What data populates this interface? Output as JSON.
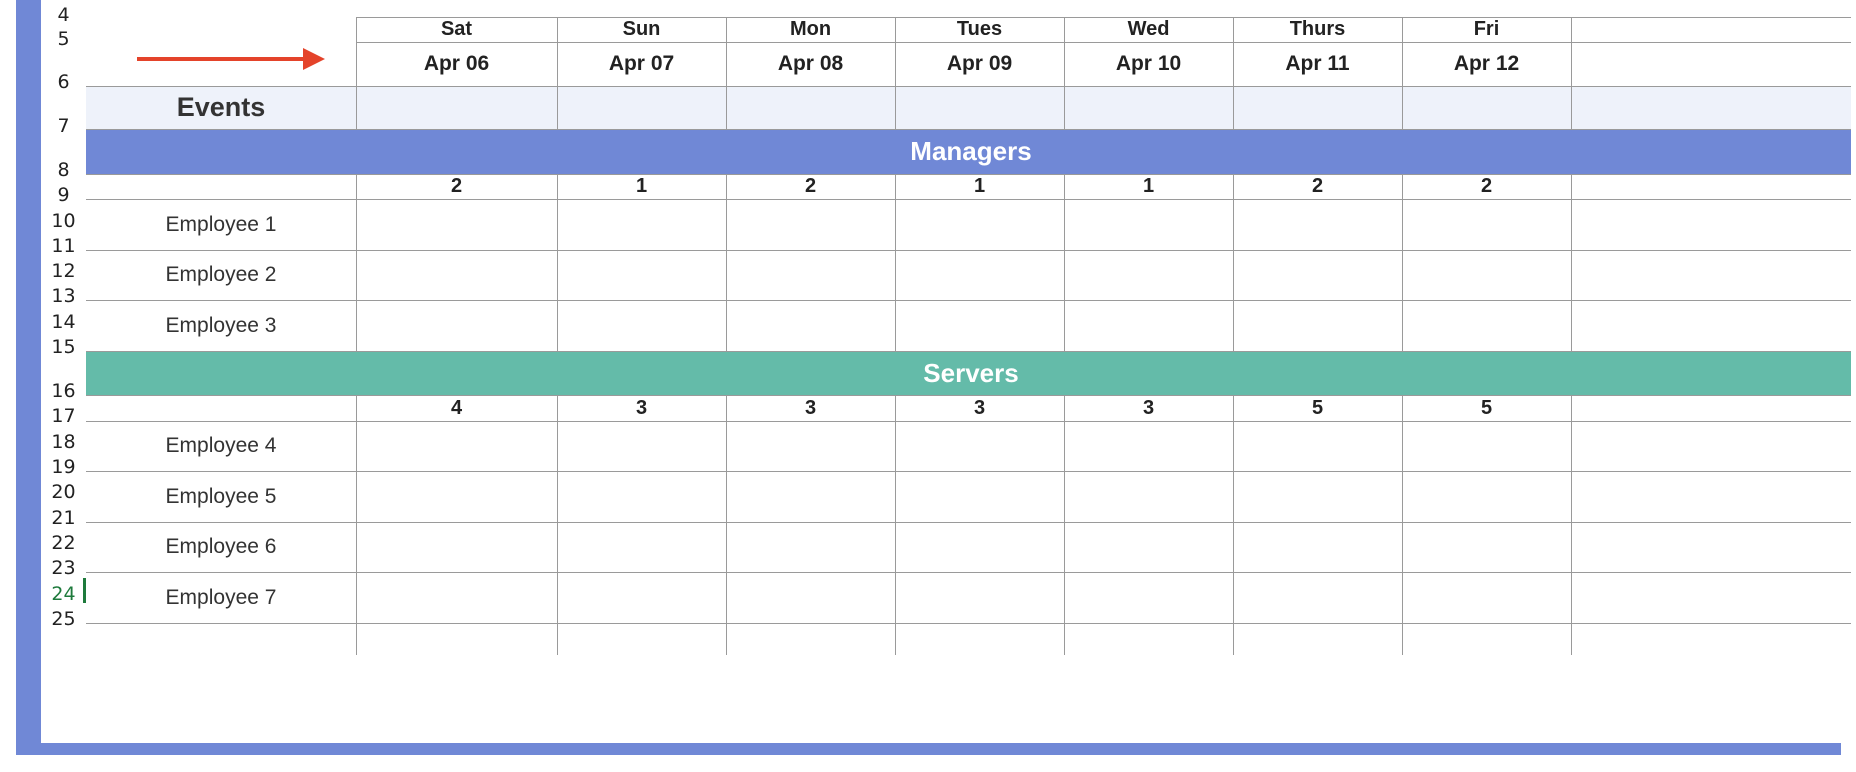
{
  "row_numbers": {
    "r4": "4",
    "r5": "5",
    "r6": "6",
    "r7": "7",
    "r8": "8",
    "r9": "9",
    "r10": "10",
    "r11": "11",
    "r12": "12",
    "r13": "13",
    "r14": "14",
    "r15": "15",
    "r16": "16",
    "r17": "17",
    "r18": "18",
    "r19": "19",
    "r20": "20",
    "r21": "21",
    "r22": "22",
    "r23": "23",
    "r24": "24",
    "r25": "25"
  },
  "days": [
    "Sat",
    "Sun",
    "Mon",
    "Tues",
    "Wed",
    "Thurs",
    "Fri"
  ],
  "dates": [
    "Apr 06",
    "Apr 07",
    "Apr 08",
    "Apr 09",
    "Apr 10",
    "Apr 11",
    "Apr 12"
  ],
  "events_label": "Events",
  "managers": {
    "title": "Managers",
    "color": "#7088d6",
    "counts": [
      "2",
      "1",
      "2",
      "1",
      "1",
      "2",
      "2"
    ],
    "employees": [
      "Employee 1",
      "Employee 2",
      "Employee 3"
    ]
  },
  "servers": {
    "title": "Servers",
    "color": "#64bba9",
    "counts": [
      "4",
      "3",
      "3",
      "3",
      "3",
      "5",
      "5"
    ],
    "employees": [
      "Employee 4",
      "Employee 5",
      "Employee 6",
      "Employee 7"
    ]
  },
  "colors": {
    "arrow": "#e4432a",
    "events_fill": "#eef2fa",
    "active_row": "#1e7a3c"
  }
}
